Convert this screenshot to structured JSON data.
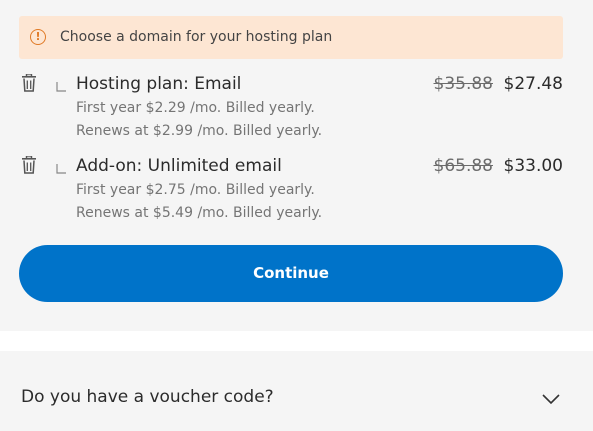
{
  "alert": {
    "icon": "exclamation-circle-icon",
    "text": "Choose a domain for your hosting plan",
    "color": "#e07a26",
    "background": "#fde6d3"
  },
  "items": [
    {
      "title": "Hosting plan: Email",
      "price_old": "$35.88",
      "price_new": "$27.48",
      "line1": "First year $2.29 /mo. Billed yearly.",
      "line2": "Renews at $2.99 /mo. Billed yearly."
    },
    {
      "title": "Add-on: Unlimited email",
      "price_old": "$65.88",
      "price_new": "$33.00",
      "line1": "First year $2.75 /mo. Billed yearly.",
      "line2": "Renews at $5.49 /mo. Billed yearly."
    }
  ],
  "continue_label": "Continue",
  "voucher": {
    "label": "Do you have a voucher code?",
    "icon": "chevron-down-icon"
  },
  "colors": {
    "accent": "#0073c9",
    "panel_bg": "#f5f5f5"
  }
}
